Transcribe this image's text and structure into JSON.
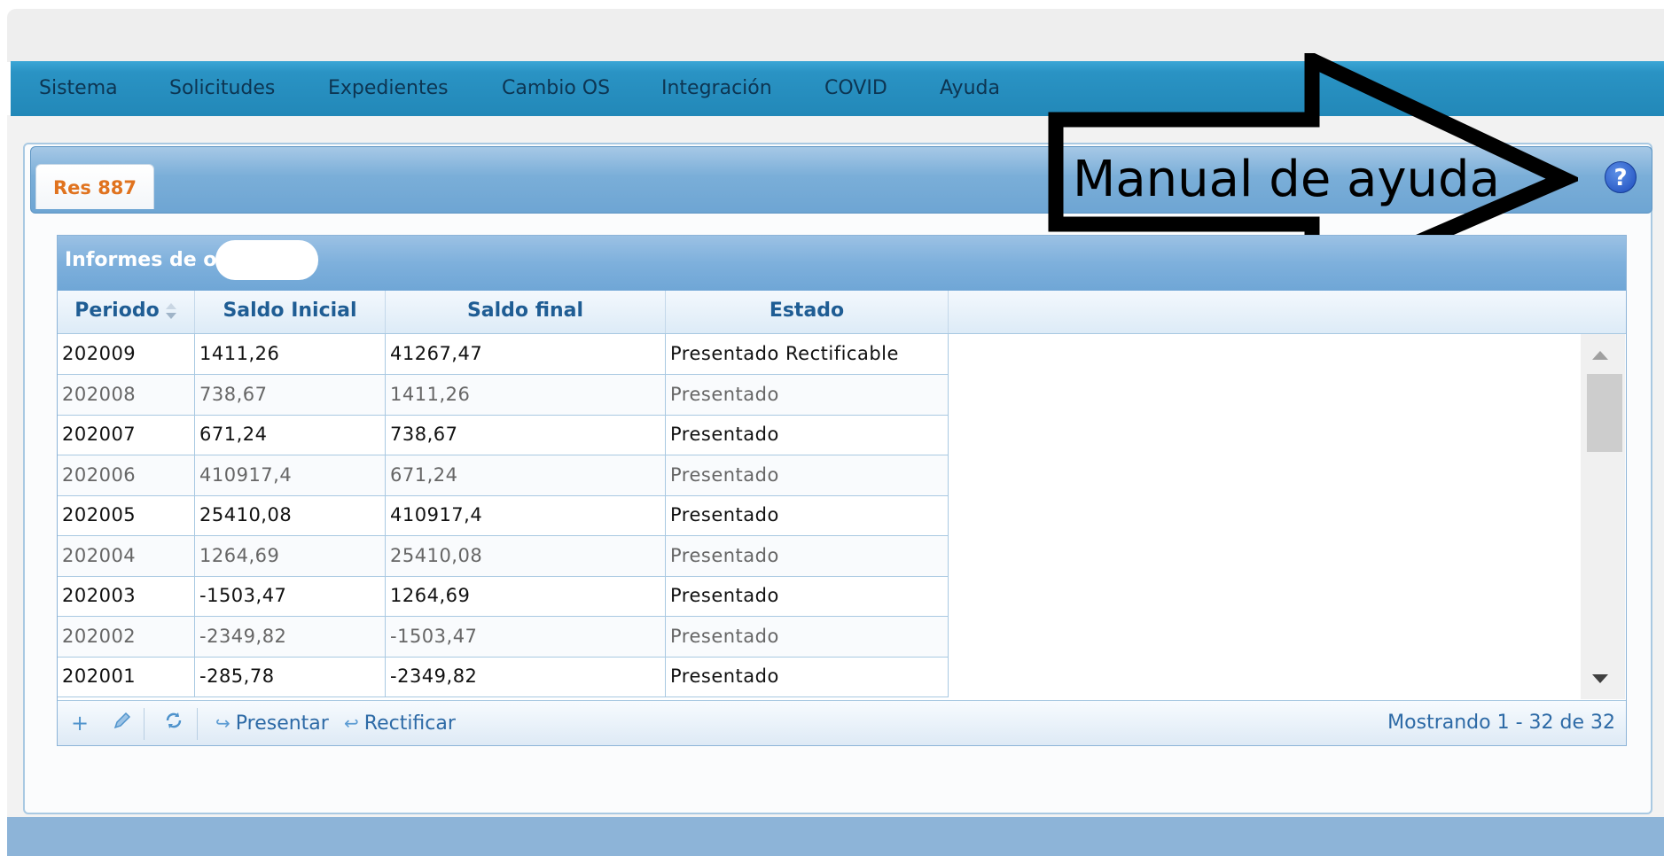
{
  "menu": {
    "items": [
      "Sistema",
      "Solicitudes",
      "Expedientes",
      "Cambio OS",
      "Integración",
      "COVID",
      "Ayuda"
    ]
  },
  "tabs": {
    "active": "Res 887"
  },
  "help": {
    "icon": "question-circle-icon",
    "glyph": "?"
  },
  "annotation": {
    "text": "Manual de ayuda"
  },
  "grid": {
    "title": "Informes de os",
    "columns": [
      "Periodo",
      "Saldo Inicial",
      "Saldo final",
      "Estado"
    ],
    "rows": [
      [
        "202009",
        "1411,26",
        "41267,47",
        "Presentado Rectificable"
      ],
      [
        "202008",
        "738,67",
        "1411,26",
        "Presentado"
      ],
      [
        "202007",
        "671,24",
        "738,67",
        "Presentado"
      ],
      [
        "202006",
        "410917,4",
        "671,24",
        "Presentado"
      ],
      [
        "202005",
        "25410,08",
        "410917,4",
        "Presentado"
      ],
      [
        "202004",
        "1264,69",
        "25410,08",
        "Presentado"
      ],
      [
        "202003",
        "-1503,47",
        "1264,69",
        "Presentado"
      ],
      [
        "202002",
        "-2349,82",
        "-1503,47",
        "Presentado"
      ],
      [
        "202001",
        "-285,78",
        "-2349,82",
        "Presentado"
      ]
    ],
    "toolbar": {
      "add_icon": "plus-icon",
      "edit_icon": "pencil-icon",
      "refresh_icon": "refresh-icon",
      "present_label": "Presentar",
      "rectify_label": "Rectificar"
    },
    "status": "Mostrando 1 - 32 de 32"
  },
  "colors": {
    "menubar": "#2288b8",
    "tab_text": "#e0731f",
    "header_text": "#1f5d94",
    "bottom_band": "#8db4d8"
  }
}
